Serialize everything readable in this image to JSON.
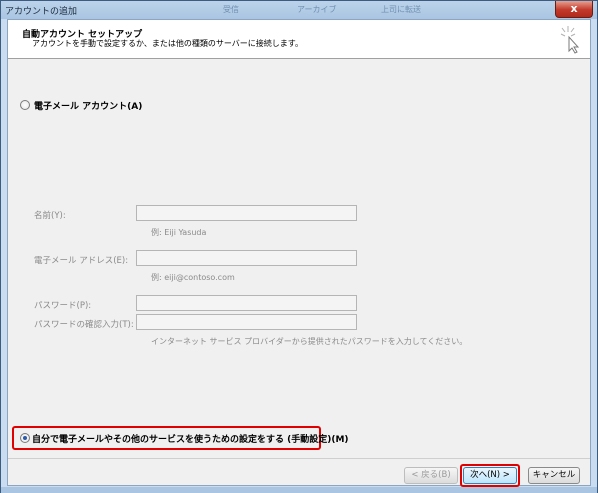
{
  "window": {
    "title": "アカウントの追加",
    "close_glyph": "x",
    "ghost_texts": [
      "受信",
      "アーカイブ",
      "上司に転送"
    ]
  },
  "header": {
    "title": "自動アカウント セットアップ",
    "subtitle": "アカウントを手動で設定するか、または他の種類のサーバーに接続します。"
  },
  "options": {
    "email_account": "電子メール アカウント(A)",
    "manual_setup": "自分で電子メールやその他のサービスを使うための設定をする (手動設定)(M)"
  },
  "fields": {
    "name_label": "名前(Y):",
    "name_hint": "例: Eiji Yasuda",
    "email_label": "電子メール アドレス(E):",
    "email_hint": "例: eiji@contoso.com",
    "password_label": "パスワード(P):",
    "password_confirm_label": "パスワードの確認入力(T):",
    "password_hint": "インターネット サービス プロバイダーから提供されたパスワードを入力してください。"
  },
  "buttons": {
    "back": "< 戻る(B)",
    "next": "次へ(N) >",
    "cancel": "キャンセル"
  }
}
